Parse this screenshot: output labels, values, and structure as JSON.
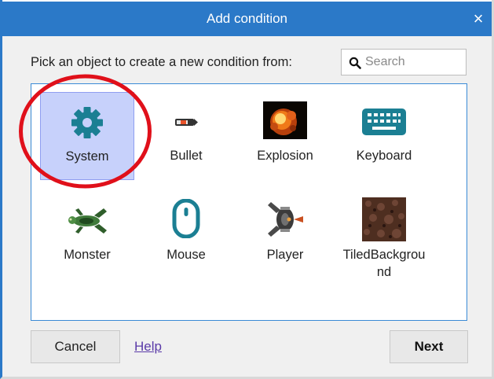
{
  "dialog": {
    "title": "Add condition",
    "close_icon": "×",
    "prompt": "Pick an object to create a new condition from:",
    "search_placeholder": "Search"
  },
  "objects": [
    {
      "label": "System",
      "icon": "gear-icon",
      "selected": true
    },
    {
      "label": "Bullet",
      "icon": "bullet-icon",
      "selected": false
    },
    {
      "label": "Explosion",
      "icon": "explosion-icon",
      "selected": false
    },
    {
      "label": "Keyboard",
      "icon": "keyboard-icon",
      "selected": false
    },
    {
      "label": "Monster",
      "icon": "monster-icon",
      "selected": false
    },
    {
      "label": "Mouse",
      "icon": "mouse-icon",
      "selected": false
    },
    {
      "label": "Player",
      "icon": "player-ship-icon",
      "selected": false
    },
    {
      "label": "TiledBackground",
      "icon": "tiled-background-icon",
      "selected": false
    }
  ],
  "buttons": {
    "cancel": "Cancel",
    "help": "Help",
    "next": "Next"
  },
  "colors": {
    "title_bar": "#2b79c8",
    "accent_icon": "#1b7f93",
    "selection": "#c7d1fb",
    "highlight_circle": "#e0101a"
  }
}
